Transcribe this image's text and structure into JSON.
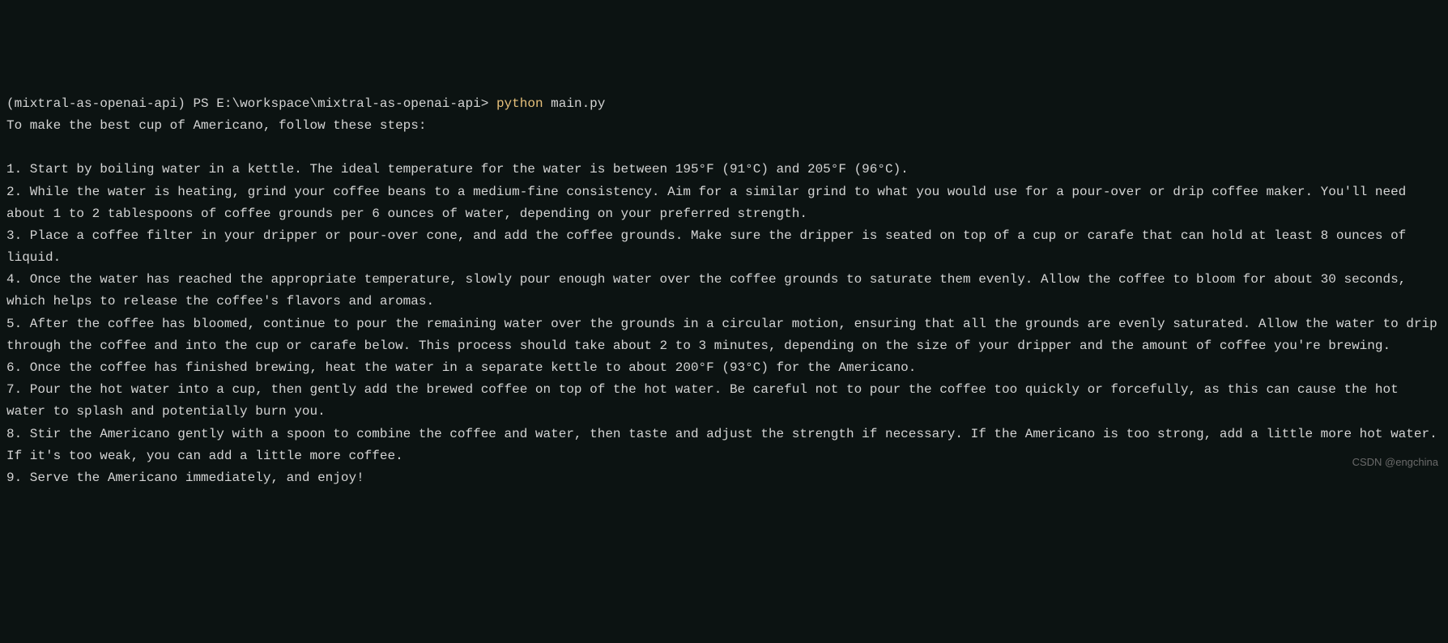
{
  "prompt": {
    "env": "(mixtral-as-openai-api)",
    "shell": "PS",
    "path": "E:\\workspace\\mixtral-as-openai-api>",
    "command_python": "python",
    "command_arg": "main.py"
  },
  "output": {
    "intro": "To make the best cup of Americano, follow these steps:",
    "steps": [
      "1. Start by boiling water in a kettle. The ideal temperature for the water is between 195°F (91°C) and 205°F (96°C).",
      "2. While the water is heating, grind your coffee beans to a medium-fine consistency. Aim for a similar grind to what you would use for a pour-over or drip coffee maker. You'll need about 1 to 2 tablespoons of coffee grounds per 6 ounces of water, depending on your preferred strength.",
      "3. Place a coffee filter in your dripper or pour-over cone, and add the coffee grounds. Make sure the dripper is seated on top of a cup or carafe that can hold at least 8 ounces of liquid.",
      "4. Once the water has reached the appropriate temperature, slowly pour enough water over the coffee grounds to saturate them evenly. Allow the coffee to bloom for about 30 seconds, which helps to release the coffee's flavors and aromas.",
      "5. After the coffee has bloomed, continue to pour the remaining water over the grounds in a circular motion, ensuring that all the grounds are evenly saturated. Allow the water to drip through the coffee and into the cup or carafe below. This process should take about 2 to 3 minutes, depending on the size of your dripper and the amount of coffee you're brewing.",
      "6. Once the coffee has finished brewing, heat the water in a separate kettle to about 200°F (93°C) for the Americano.",
      "7. Pour the hot water into a cup, then gently add the brewed coffee on top of the hot water. Be careful not to pour the coffee too quickly or forcefully, as this can cause the hot water to splash and potentially burn you.",
      "8. Stir the Americano gently with a spoon to combine the coffee and water, then taste and adjust the strength if necessary. If the Americano is too strong, add a little more hot water. If it's too weak, you can add a little more coffee.",
      "9. Serve the Americano immediately, and enjoy!"
    ]
  },
  "watermark": "CSDN @engchina"
}
